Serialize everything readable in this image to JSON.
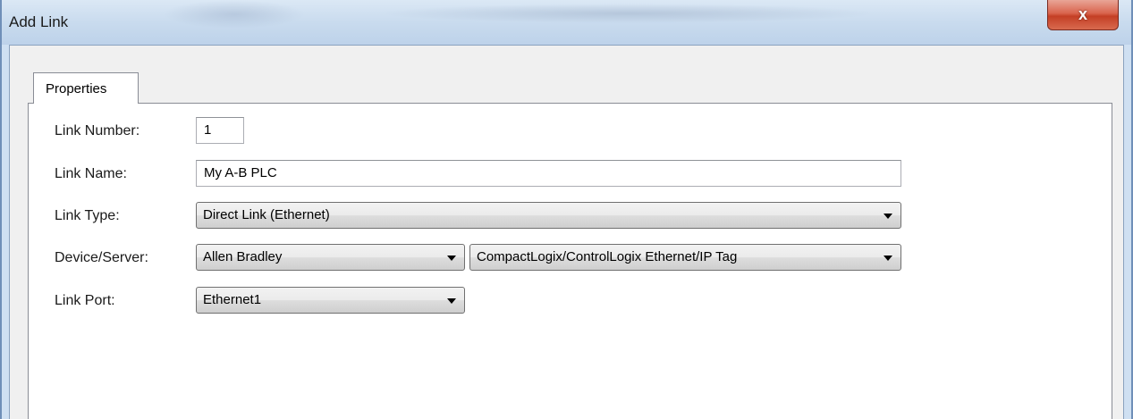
{
  "window": {
    "title": "Add Link",
    "close_label": "x"
  },
  "tabs": [
    {
      "label": "Properties",
      "active": true
    }
  ],
  "form": {
    "link_number": {
      "label": "Link Number:",
      "value": "1"
    },
    "link_name": {
      "label": "Link Name:",
      "value": "My A-B PLC"
    },
    "link_type": {
      "label": "Link Type:",
      "selected": "Direct Link (Ethernet)"
    },
    "device_server": {
      "label": "Device/Server:",
      "vendor_selected": "Allen Bradley",
      "driver_selected": "CompactLogix/ControlLogix Ethernet/IP Tag"
    },
    "link_port": {
      "label": "Link Port:",
      "selected": "Ethernet1"
    }
  },
  "colors": {
    "titlebar": "#c9dbee",
    "close_button": "#c43f25",
    "dialog_background": "#f0f0f0",
    "panel_background": "#ffffff"
  }
}
